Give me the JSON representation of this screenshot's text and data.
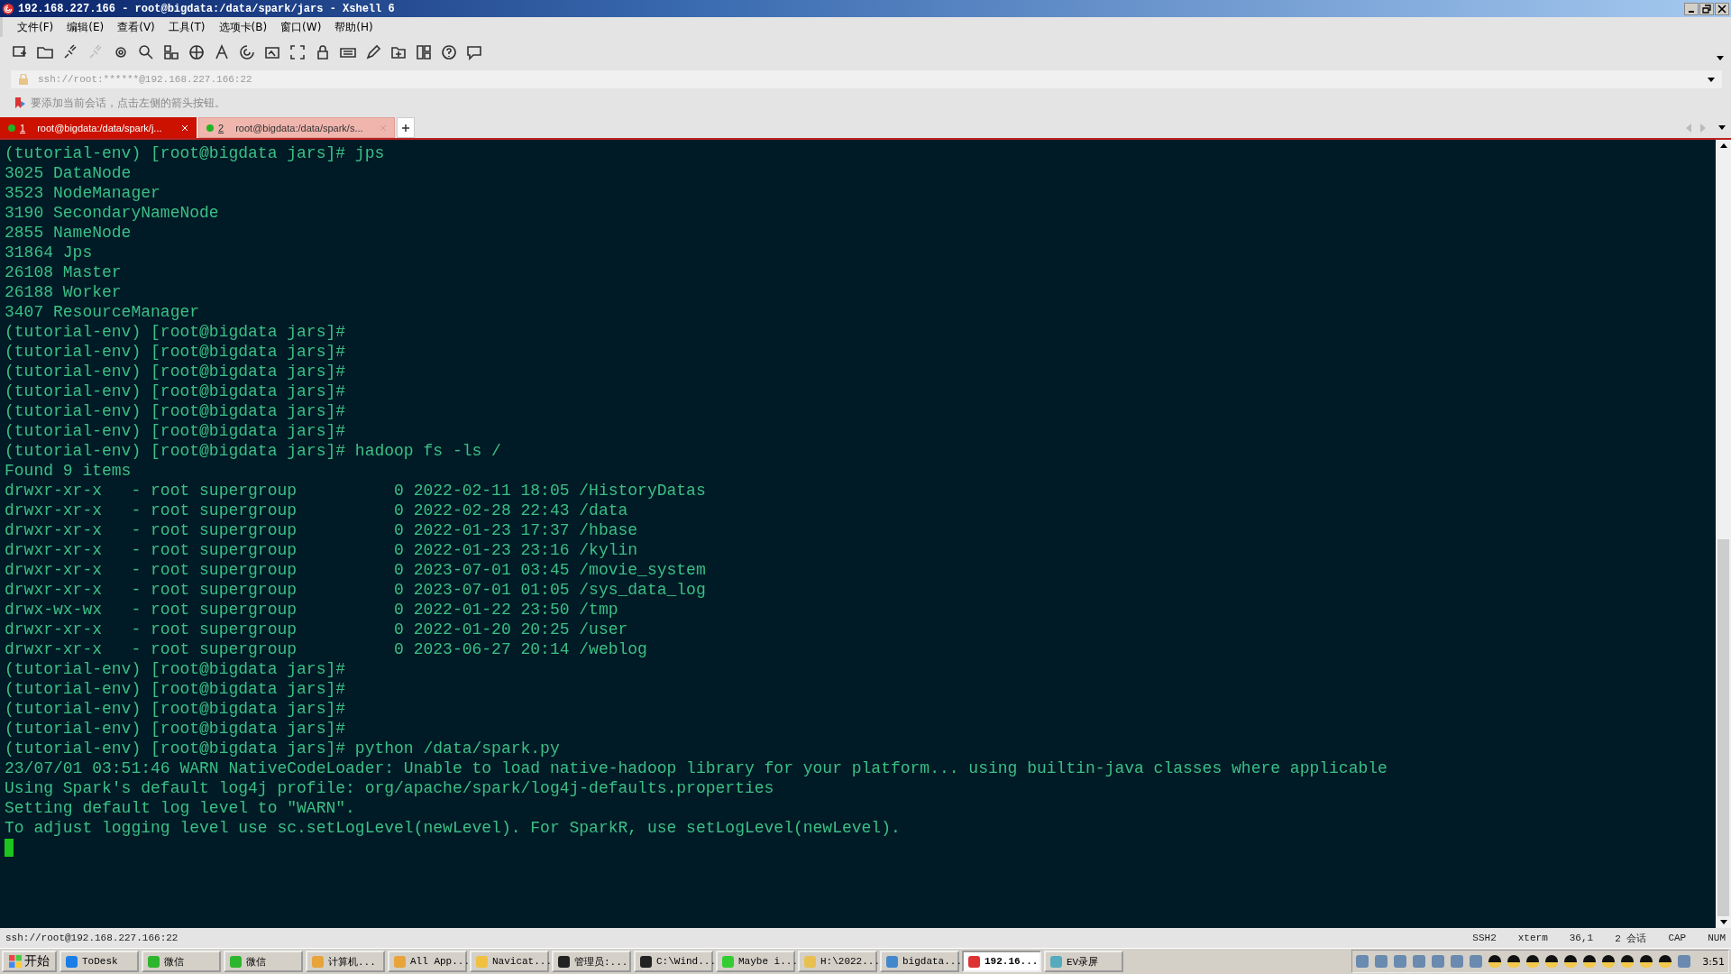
{
  "window": {
    "title": "192.168.227.166 - root@bigdata:/data/spark/jars - Xshell 6"
  },
  "menu": [
    "文件(F)",
    "编辑(E)",
    "查看(V)",
    "工具(T)",
    "选项卡(B)",
    "窗口(W)",
    "帮助(H)"
  ],
  "address_bar": {
    "value": "ssh://root:******@192.168.227.166:22"
  },
  "hint": "要添加当前会话，点击左侧的箭头按钮。",
  "tabs": [
    {
      "number": "1",
      "label": "root@bigdata:/data/spark/j...",
      "selected": true
    },
    {
      "number": "2",
      "label": "root@bigdata:/data/spark/s...",
      "selected": false
    }
  ],
  "terminal": {
    "lines": [
      "(tutorial-env) [root@bigdata jars]# jps",
      "3025 DataNode",
      "3523 NodeManager",
      "3190 SecondaryNameNode",
      "2855 NameNode",
      "31864 Jps",
      "26108 Master",
      "26188 Worker",
      "3407 ResourceManager",
      "(tutorial-env) [root@bigdata jars]#",
      "(tutorial-env) [root@bigdata jars]#",
      "(tutorial-env) [root@bigdata jars]#",
      "(tutorial-env) [root@bigdata jars]#",
      "(tutorial-env) [root@bigdata jars]#",
      "(tutorial-env) [root@bigdata jars]#",
      "(tutorial-env) [root@bigdata jars]# hadoop fs -ls /",
      "Found 9 items",
      "drwxr-xr-x   - root supergroup          0 2022-02-11 18:05 /HistoryDatas",
      "drwxr-xr-x   - root supergroup          0 2022-02-28 22:43 /data",
      "drwxr-xr-x   - root supergroup          0 2022-01-23 17:37 /hbase",
      "drwxr-xr-x   - root supergroup          0 2022-01-23 23:16 /kylin",
      "drwxr-xr-x   - root supergroup          0 2023-07-01 03:45 /movie_system",
      "drwxr-xr-x   - root supergroup          0 2023-07-01 01:05 /sys_data_log",
      "drwx-wx-wx   - root supergroup          0 2022-01-22 23:50 /tmp",
      "drwxr-xr-x   - root supergroup          0 2022-01-20 20:25 /user",
      "drwxr-xr-x   - root supergroup          0 2023-06-27 20:14 /weblog",
      "(tutorial-env) [root@bigdata jars]#",
      "(tutorial-env) [root@bigdata jars]#",
      "(tutorial-env) [root@bigdata jars]#",
      "(tutorial-env) [root@bigdata jars]#",
      "(tutorial-env) [root@bigdata jars]# python /data/spark.py",
      "23/07/01 03:51:46 WARN NativeCodeLoader: Unable to load native-hadoop library for your platform... using builtin-java classes where applicable",
      "Using Spark's default log4j profile: org/apache/spark/log4j-defaults.properties",
      "Setting default log level to \"WARN\".",
      "To adjust logging level use sc.setLogLevel(newLevel). For SparkR, use setLogLevel(newLevel)."
    ]
  },
  "status_bar": {
    "connection": "ssh://root@192.168.227.166:22",
    "items": [
      "SSH2",
      "xterm",
      "36,1",
      "2 会话",
      "CAP",
      "NUM"
    ]
  },
  "taskbar": {
    "start": "开始",
    "buttons": [
      {
        "label": "ToDesk",
        "selected": false
      },
      {
        "label": "微信",
        "selected": false
      },
      {
        "label": "微信",
        "selected": false
      },
      {
        "label": "计算机...",
        "selected": false
      },
      {
        "label": "All App...",
        "selected": false
      },
      {
        "label": "Navicat...",
        "selected": false
      },
      {
        "label": "管理员:...",
        "selected": false
      },
      {
        "label": "C:\\Wind...",
        "selected": false
      },
      {
        "label": "Maybe i...",
        "selected": false
      },
      {
        "label": "H:\\2022...",
        "selected": false
      },
      {
        "label": "bigdata...",
        "selected": false
      },
      {
        "label": "192.16...",
        "selected": true
      },
      {
        "label": "EV录屏",
        "selected": false
      }
    ],
    "clock": "3:51"
  }
}
